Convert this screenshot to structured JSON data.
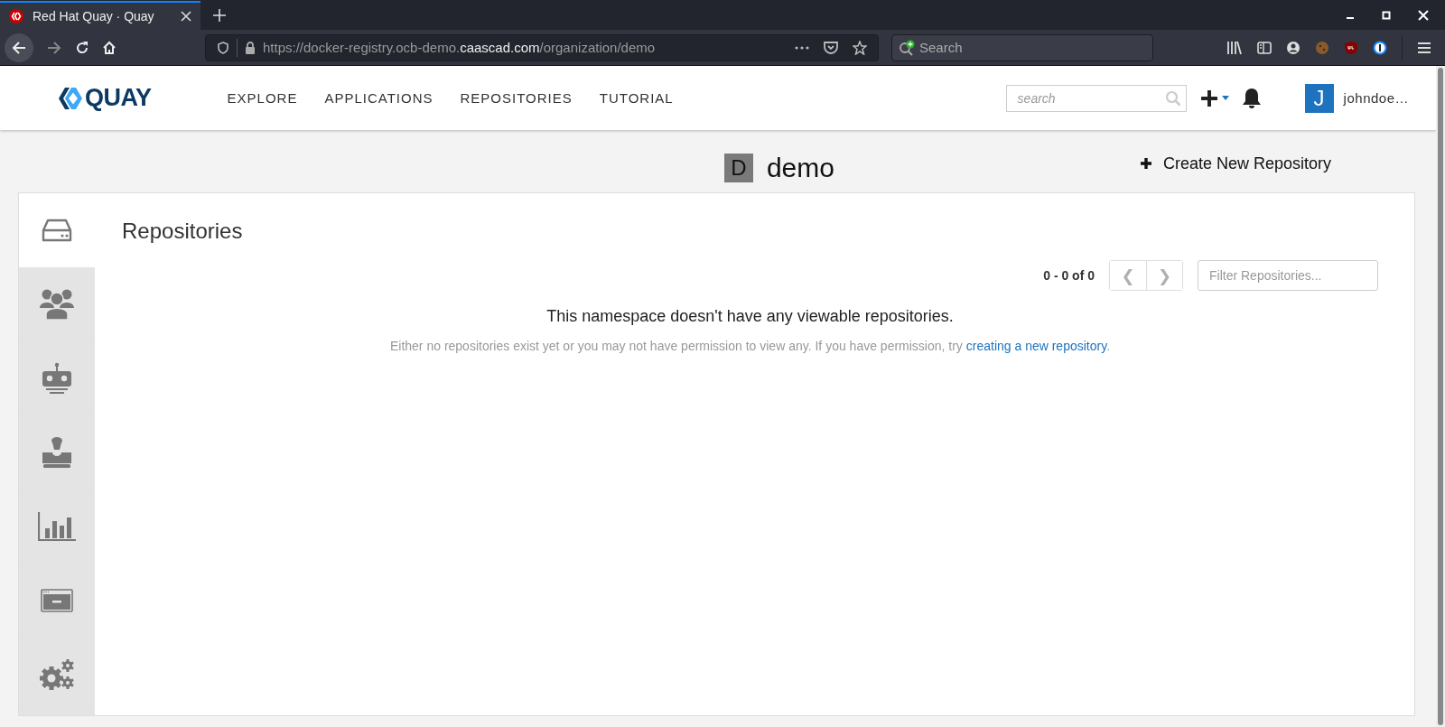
{
  "browser": {
    "tab_title": "Red Hat Quay · Quay",
    "url": {
      "scheme_host": "https://docker-registry.ocb-demo.",
      "domain": "caascad.com",
      "path": "/organization/demo"
    },
    "search_placeholder": "Search"
  },
  "header": {
    "logo_text": "QUAY",
    "nav": [
      "EXPLORE",
      "APPLICATIONS",
      "REPOSITORIES",
      "TUTORIAL"
    ],
    "search_placeholder": "search",
    "avatar_letter": "J",
    "username": "johndoe…"
  },
  "namespace": {
    "avatar_letter": "D",
    "name": "demo",
    "create_button": "Create New Repository"
  },
  "sidebar": {
    "items": [
      {
        "kind": "repositories",
        "selected": true
      },
      {
        "kind": "teams",
        "selected": false
      },
      {
        "kind": "robots",
        "selected": false
      },
      {
        "kind": "permissions",
        "selected": false
      },
      {
        "kind": "usage",
        "selected": false
      },
      {
        "kind": "applications",
        "selected": false
      },
      {
        "kind": "settings",
        "selected": false
      }
    ]
  },
  "content": {
    "heading": "Repositories",
    "pagination": "0 - 0 of 0",
    "prev": {
      "label": "❮",
      "disabled": true
    },
    "next": {
      "label": "❯",
      "disabled": true
    },
    "filter_placeholder": "Filter Repositories...",
    "empty_title": "This namespace doesn't have any viewable repositories.",
    "empty_hint": "Either no repositories exist yet or you may not have permission to view any. If you have permission, try ",
    "empty_link": "creating a new repository",
    "empty_end": "."
  }
}
